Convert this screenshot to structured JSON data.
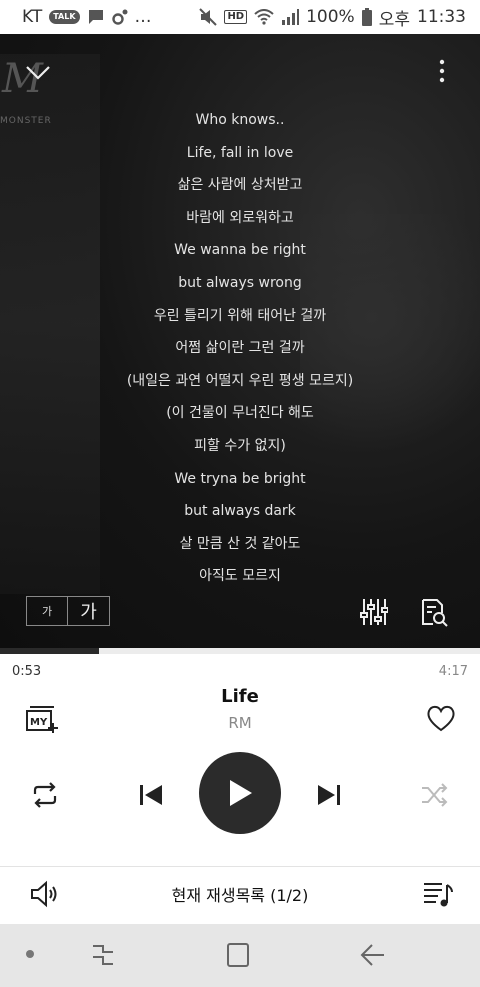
{
  "status_bar": {
    "carrier": "KT",
    "talk_badge": "TALK",
    "battery": "100%",
    "ampm": "오후",
    "time": "11:33",
    "hd": "HD",
    "more": "…"
  },
  "art": {
    "logo_letter": "M",
    "logo_text": "MONSTER"
  },
  "lyrics": [
    "Who knows..",
    "Life, fall in love",
    "삶은 사람에 상처받고",
    "바람에 외로워하고",
    "We wanna be right",
    "but always wrong",
    "우린 틀리기 위해 태어난 걸까",
    "어쩜 삶이란 그런 걸까",
    "(내일은 과연 어떨지 우린 평생 모르지)",
    "(이 건물이 무너진다 해도",
    "피할 수가 없지)",
    "We tryna be bright",
    "but always dark",
    "살 만큼 산 것 같아도",
    "아직도 모르지"
  ],
  "font_toggle": {
    "small": "가",
    "large": "가"
  },
  "player": {
    "current_time": "0:53",
    "total_time": "4:17",
    "progress": 0.206,
    "title": "Life",
    "artist": "RM",
    "my_label": "MY"
  },
  "bottom": {
    "playlist_label": "현재 재생목록 (1/2)"
  },
  "icons": {
    "collapse": "chevron-down-icon",
    "more": "more-vert-icon",
    "equalizer": "equalizer-icon",
    "lyric_search": "lyrics-search-icon",
    "heart": "heart-icon",
    "repeat": "repeat-icon",
    "prev": "skip-previous-icon",
    "play": "play-icon",
    "next": "skip-next-icon",
    "shuffle": "shuffle-icon",
    "volume": "volume-icon",
    "playlist": "playlist-icon"
  },
  "colors": {
    "accent": "#2b2b2b",
    "lyric_text": "#e4e4e4",
    "background": "#ffffff"
  }
}
